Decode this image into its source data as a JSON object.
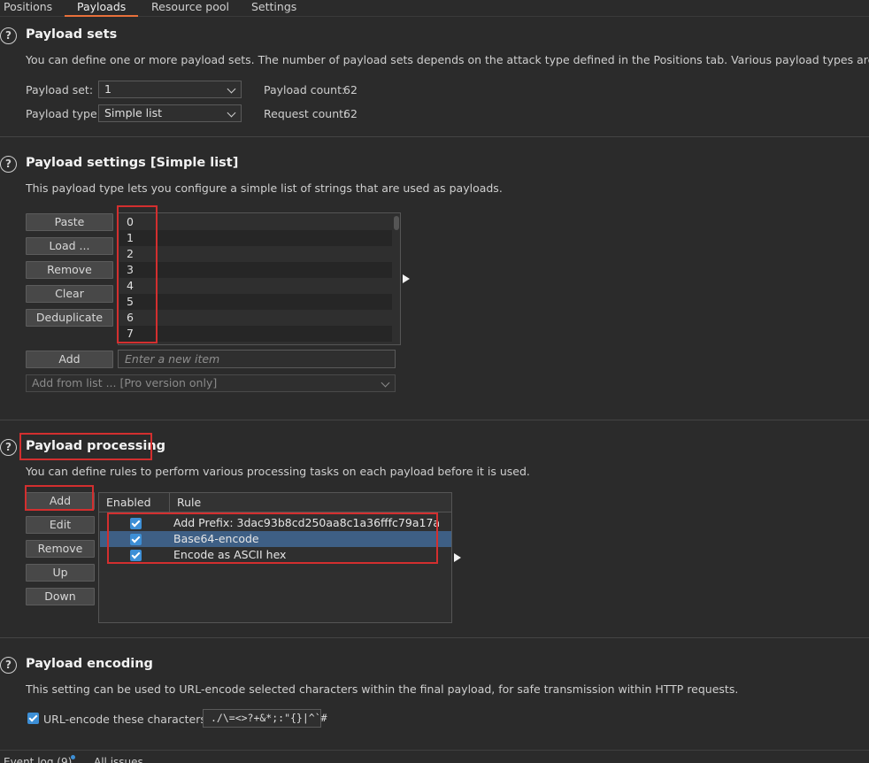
{
  "tabs": {
    "positions": "Positions",
    "payloads": "Payloads",
    "resource_pool": "Resource pool",
    "settings": "Settings"
  },
  "payload_sets": {
    "title": "Payload sets",
    "description": "You can define one or more payload sets. The number of payload sets depends on the attack type defined in the Positions tab. Various payload types are available for ea",
    "set_label": "Payload set:",
    "set_value": "1",
    "type_label": "Payload type:",
    "type_value": "Simple list",
    "count_label": "Payload count:",
    "count_value": "62",
    "request_label": "Request count:",
    "request_value": "62"
  },
  "payload_settings": {
    "title": "Payload settings [Simple list]",
    "description": "This payload type lets you configure a simple list of strings that are used as payloads.",
    "buttons": {
      "paste": "Paste",
      "load": "Load ...",
      "remove": "Remove",
      "clear": "Clear",
      "deduplicate": "Deduplicate",
      "add": "Add"
    },
    "items": [
      "0",
      "1",
      "2",
      "3",
      "4",
      "5",
      "6",
      "7"
    ],
    "new_item_placeholder": "Enter a new item",
    "add_from_list": "Add from list ... [Pro version only]"
  },
  "payload_processing": {
    "title": "Payload processing",
    "description": "You can define rules to perform various processing tasks on each payload before it is used.",
    "buttons": {
      "add": "Add",
      "edit": "Edit",
      "remove": "Remove",
      "up": "Up",
      "down": "Down"
    },
    "columns": {
      "enabled": "Enabled",
      "rule": "Rule"
    },
    "rules": [
      {
        "enabled": true,
        "rule": "Add Prefix: 3dac93b8cd250aa8c1a36fffc79a17a"
      },
      {
        "enabled": true,
        "rule": "Base64-encode"
      },
      {
        "enabled": true,
        "rule": "Encode as ASCII hex"
      }
    ]
  },
  "payload_encoding": {
    "title": "Payload encoding",
    "description": "This setting can be used to URL-encode selected characters within the final payload, for safe transmission within HTTP requests.",
    "checkbox_label": "URL-encode these characters:",
    "characters": "./\\=<>?+&*;:\"{}|^`#"
  },
  "bottom": {
    "event_log": "Event log (9)",
    "all_issues": "All issues"
  },
  "colors": {
    "accent": "#e8703a",
    "selection": "#3e5f85",
    "checkbox": "#3d8fd6",
    "highlight_box": "#d32f2f"
  }
}
